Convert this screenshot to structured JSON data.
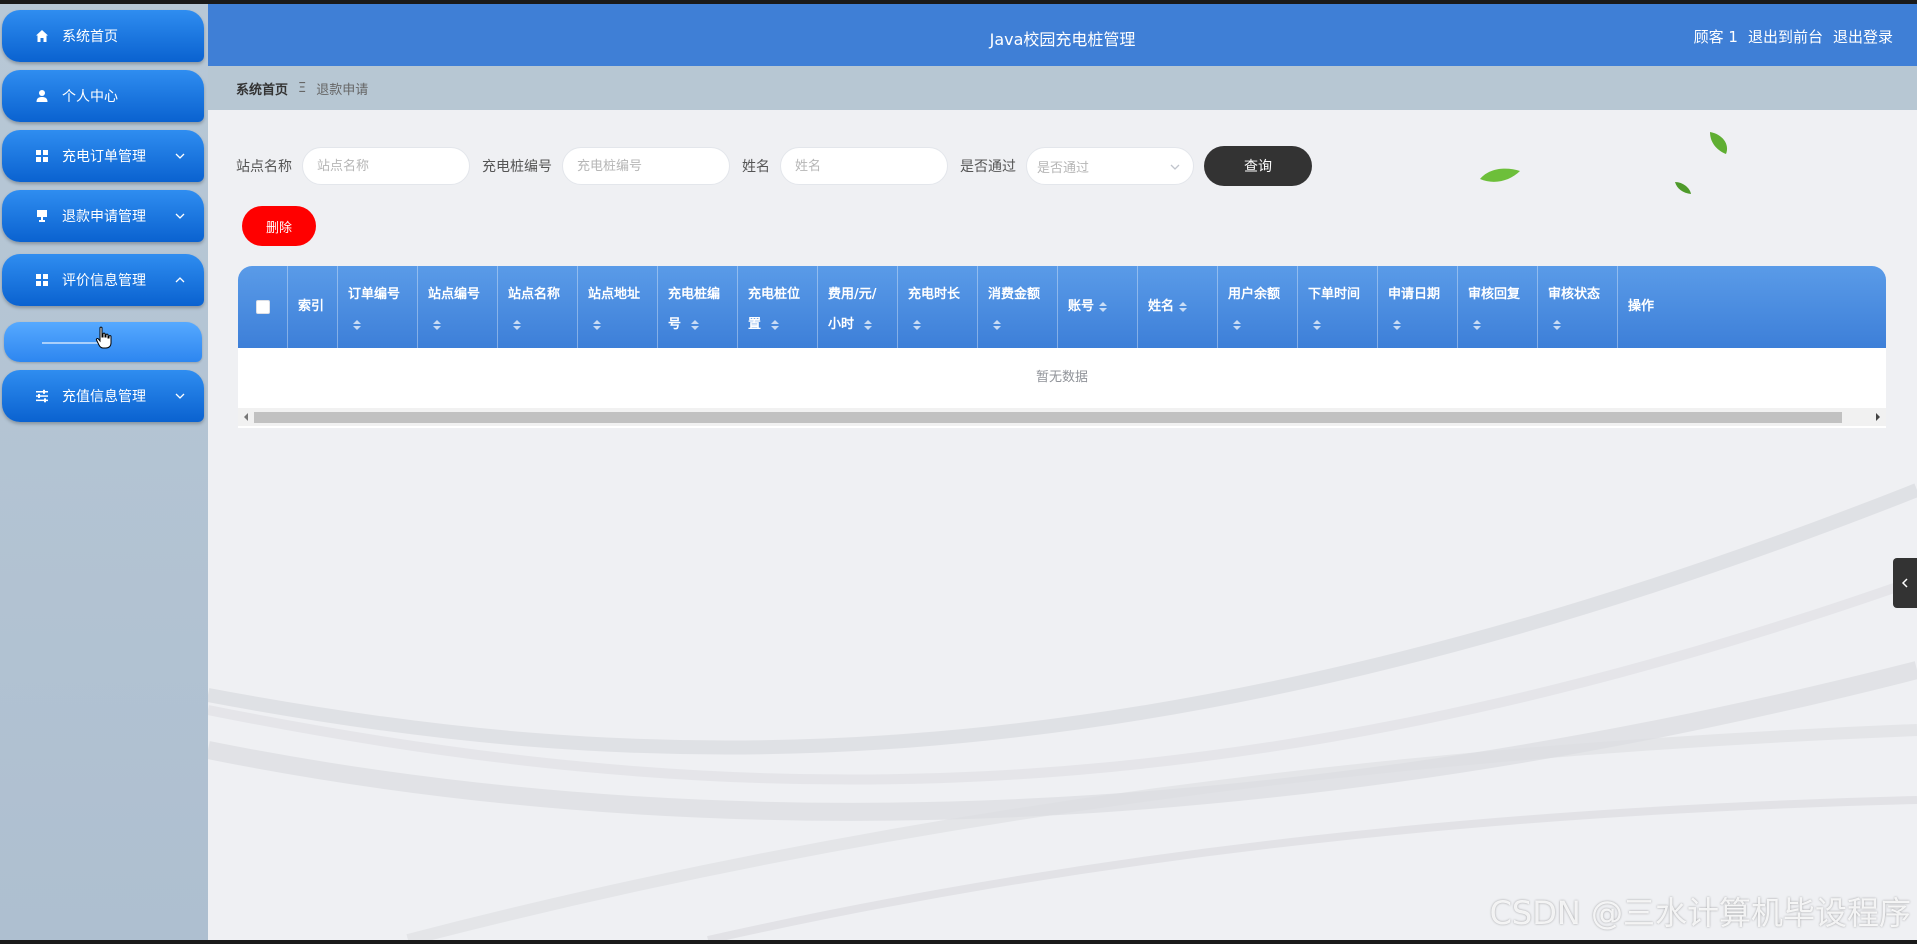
{
  "header": {
    "title": "Java校园充电桩管理",
    "user_label": "顾客 1",
    "to_front_label": "退出到前台",
    "logout_label": "退出登录"
  },
  "sidebar": {
    "items": [
      {
        "label": "系统首页",
        "icon": "home-icon"
      },
      {
        "label": "个人中心",
        "icon": "user-icon"
      },
      {
        "label": "充电订单管理",
        "icon": "grid-icon"
      },
      {
        "label": "退款申请管理",
        "icon": "monitor-icon"
      },
      {
        "label": "评价信息管理",
        "icon": "grid-icon",
        "expanded": true
      },
      {
        "label": "充值信息管理",
        "icon": "sliders-icon"
      }
    ]
  },
  "breadcrumb": {
    "home": "系统首页",
    "separator": "Ξ",
    "current": "退款申请"
  },
  "search": {
    "station_name_label": "站点名称",
    "station_name_placeholder": "站点名称",
    "pile_no_label": "充电桩编号",
    "pile_no_placeholder": "充电桩编号",
    "name_label": "姓名",
    "name_placeholder": "姓名",
    "approved_label": "是否通过",
    "approved_placeholder": "是否通过",
    "query_button": "查询"
  },
  "actions": {
    "delete_button": "删除"
  },
  "table": {
    "columns": [
      {
        "label": "索引",
        "sortable": false
      },
      {
        "label": "订单编号",
        "sortable": true
      },
      {
        "label": "站点编号",
        "sortable": true
      },
      {
        "label": "站点名称",
        "sortable": true
      },
      {
        "label": "站点地址",
        "sortable": true
      },
      {
        "label": "充电桩编号",
        "sortable": true
      },
      {
        "label": "充电桩位置",
        "sortable": true
      },
      {
        "label": "费用/元/小时",
        "sortable": true
      },
      {
        "label": "充电时长",
        "sortable": true
      },
      {
        "label": "消费金额",
        "sortable": true
      },
      {
        "label": "账号",
        "sortable": true
      },
      {
        "label": "姓名",
        "sortable": true
      },
      {
        "label": "用户余额",
        "sortable": true
      },
      {
        "label": "下单时间",
        "sortable": true
      },
      {
        "label": "申请日期",
        "sortable": true
      },
      {
        "label": "审核回复",
        "sortable": true
      },
      {
        "label": "审核状态",
        "sortable": true
      },
      {
        "label": "操作",
        "sortable": false
      }
    ],
    "empty_text": "暂无数据"
  },
  "watermark": "CSDN @三水计算机毕设程序",
  "colors": {
    "header_bg": "#3f7fd6",
    "nav_bg": "#0a62d0",
    "delete_bg": "#ff0000",
    "query_bg": "#333333"
  }
}
